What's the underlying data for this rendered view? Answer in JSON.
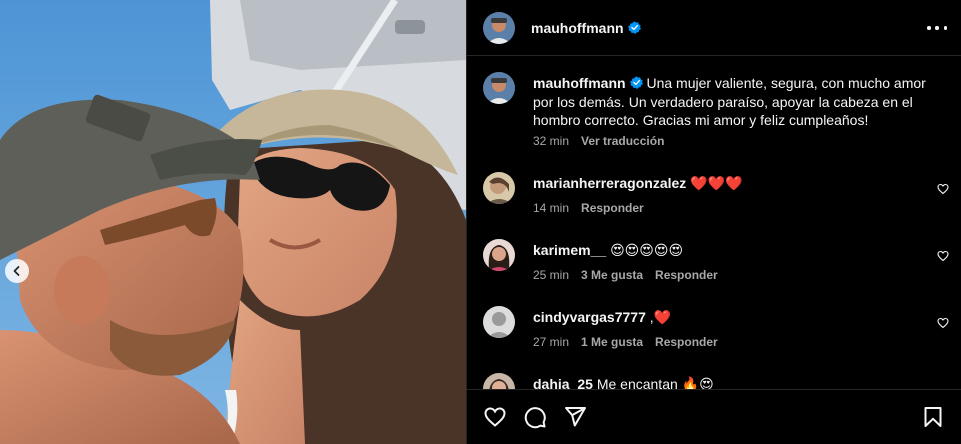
{
  "post": {
    "username": "mauhoffmann",
    "verified": true,
    "caption": "Una mujer valiente, segura, con mucho amor por los demás. Un verdadero paraíso, apoyar la cabeza en el hombro correcto. Gracias mi amor y feliz cumpleaños!",
    "time": "32 min",
    "translate_label": "Ver traducción"
  },
  "comments": [
    {
      "username": "marianherreragonzalez",
      "text": "❤️❤️❤️",
      "time": "14 min",
      "likes": "",
      "reply_label": "Responder"
    },
    {
      "username": "karimem__",
      "text": "😍😍😍😍😍",
      "time": "25 min",
      "likes": "3 Me gusta",
      "reply_label": "Responder"
    },
    {
      "username": "cindyvargas7777",
      "text": ",❤️",
      "time": "27 min",
      "likes": "1 Me gusta",
      "reply_label": "Responder"
    },
    {
      "username": "dahia_25",
      "text": "Me encantan 🔥😍",
      "time": "",
      "likes": "",
      "reply_label": ""
    }
  ],
  "icons": {
    "more": "more-options-icon",
    "verified": "verified-badge-icon",
    "carousel_prev": "chevron-left-icon",
    "like": "heart-icon",
    "comment": "comment-icon",
    "share": "share-icon",
    "save": "bookmark-icon"
  },
  "colors": {
    "verified": "#0095f6",
    "heart": "#ff3040",
    "muted": "#a8a8a8"
  }
}
